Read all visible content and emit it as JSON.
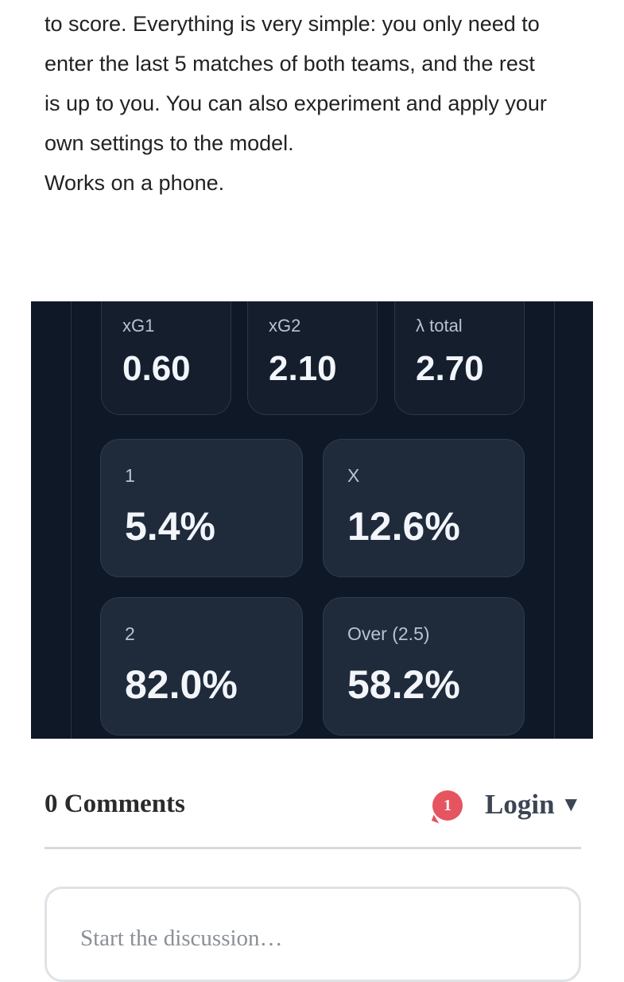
{
  "intro": {
    "lines": [
      "to score. Everything is very simple: you only need to",
      "enter the last 5 matches of both teams, and the rest",
      "is up to you. You can also experiment and apply your",
      "own settings to the model.",
      "Works on a phone."
    ]
  },
  "stats": {
    "xg1": {
      "label": "xG1",
      "value": "0.60"
    },
    "xg2": {
      "label": "xG2",
      "value": "2.10"
    },
    "lambda": {
      "label": "λ total",
      "value": "2.70"
    },
    "home": {
      "label": "1",
      "value": "5.4%"
    },
    "draw": {
      "label": "X",
      "value": "12.6%"
    },
    "away": {
      "label": "2",
      "value": "82.0%"
    },
    "over": {
      "label": "Over (2.5)",
      "value": "58.2%"
    }
  },
  "comments": {
    "title": "0 Comments",
    "notification_count": "1",
    "login_label": "Login",
    "login_caret": "▼",
    "placeholder": "Start the discussion…"
  },
  "colors": {
    "panel_bg": "#0f1826",
    "card_bg": "#1f2a3a",
    "notif_red": "#e5545f"
  }
}
